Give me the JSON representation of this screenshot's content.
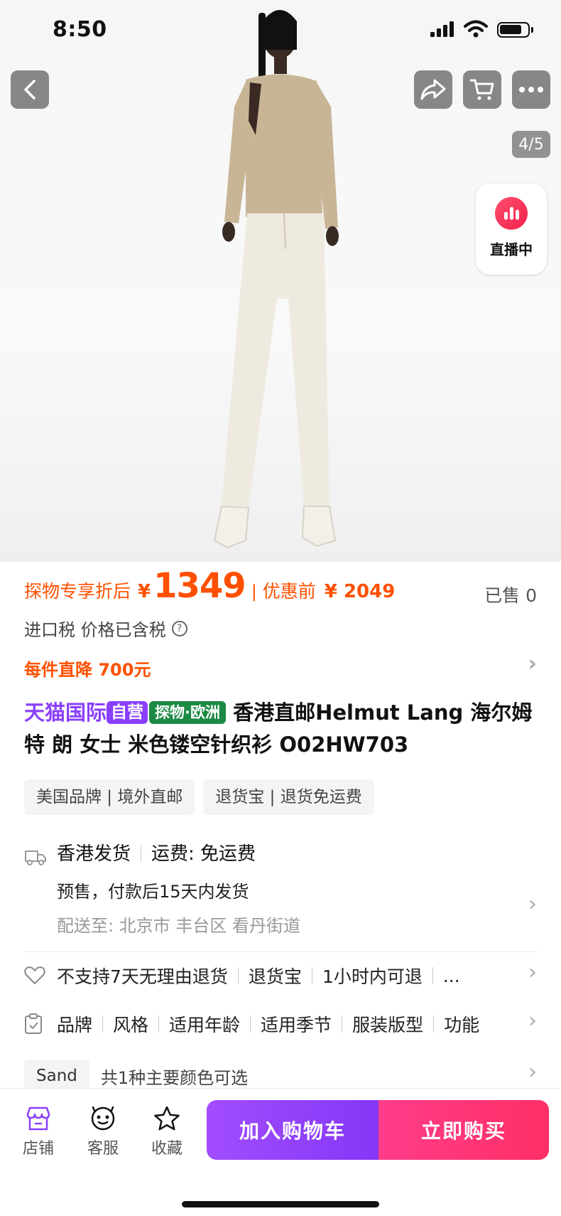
{
  "status": {
    "time": "8:50"
  },
  "gallery": {
    "page_indicator": "4/5"
  },
  "live": {
    "label": "直播中"
  },
  "price": {
    "label": "探物专享折后",
    "currency": "¥",
    "amount": "1349",
    "separator": "|",
    "before_label": "优惠前",
    "before_value": "¥ 2049",
    "sold": "已售 0"
  },
  "tax": {
    "text": "进口税 价格已含税",
    "help": "?"
  },
  "discount": {
    "text": "每件直降 700元"
  },
  "product": {
    "tag_tmall": "天猫国际",
    "tag_self": "自营",
    "tag_eu": "探物·欧洲",
    "title": " 香港直邮Helmut Lang 海尔姆特 朗 女士 米色镂空针织衫 O02HW703"
  },
  "pills": [
    "美国品牌 | 境外直邮",
    "退货宝 | 退货免运费"
  ],
  "shipping": {
    "origin": "香港发货",
    "fee": "运费: 免运费",
    "presale": "预售，付款后15天内发货",
    "deliver_to": "配送至: 北京市 丰台区 看丹街道"
  },
  "services": [
    "不支持7天无理由退货",
    "退货宝",
    "1小时内可退",
    "..."
  ],
  "params": [
    "品牌",
    "风格",
    "适用年龄",
    "适用季节",
    "服装版型",
    "功能"
  ],
  "color": {
    "chip": "Sand",
    "text": "共1种主要颜色可选"
  },
  "bottom": {
    "shop": "店铺",
    "service": "客服",
    "favorite": "收藏",
    "add_cart": "加入购物车",
    "buy_now": "立即购买"
  },
  "colors": {
    "accent_orange": "#ff5000",
    "tmall_purple": "#8a3ffc",
    "buy_pink": "#ff2f66"
  }
}
